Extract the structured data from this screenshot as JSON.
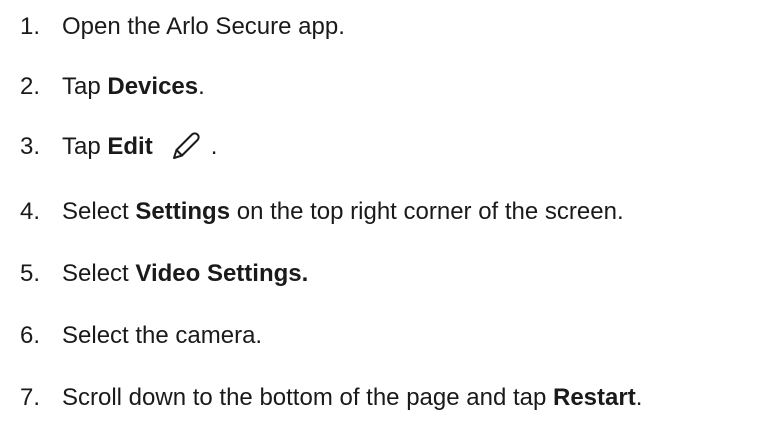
{
  "steps": [
    {
      "number": "1.",
      "text": "Open the Arlo Secure app."
    },
    {
      "number": "2.",
      "before": "Tap ",
      "bold": "Devices",
      "after": "."
    },
    {
      "number": "3.",
      "before": "Tap ",
      "bold": "Edit",
      "icon": "pencil-edit-icon",
      "after": "."
    },
    {
      "number": "4.",
      "before": "Select ",
      "bold": "Settings",
      "after": " on the top right corner of the screen."
    },
    {
      "number": "5.",
      "before": "Select ",
      "bold": "Video Settings."
    },
    {
      "number": "6.",
      "text": "Select the camera."
    },
    {
      "number": "7.",
      "before": "Scroll down to the bottom of the page and tap ",
      "bold": "Restart",
      "after": "."
    }
  ]
}
